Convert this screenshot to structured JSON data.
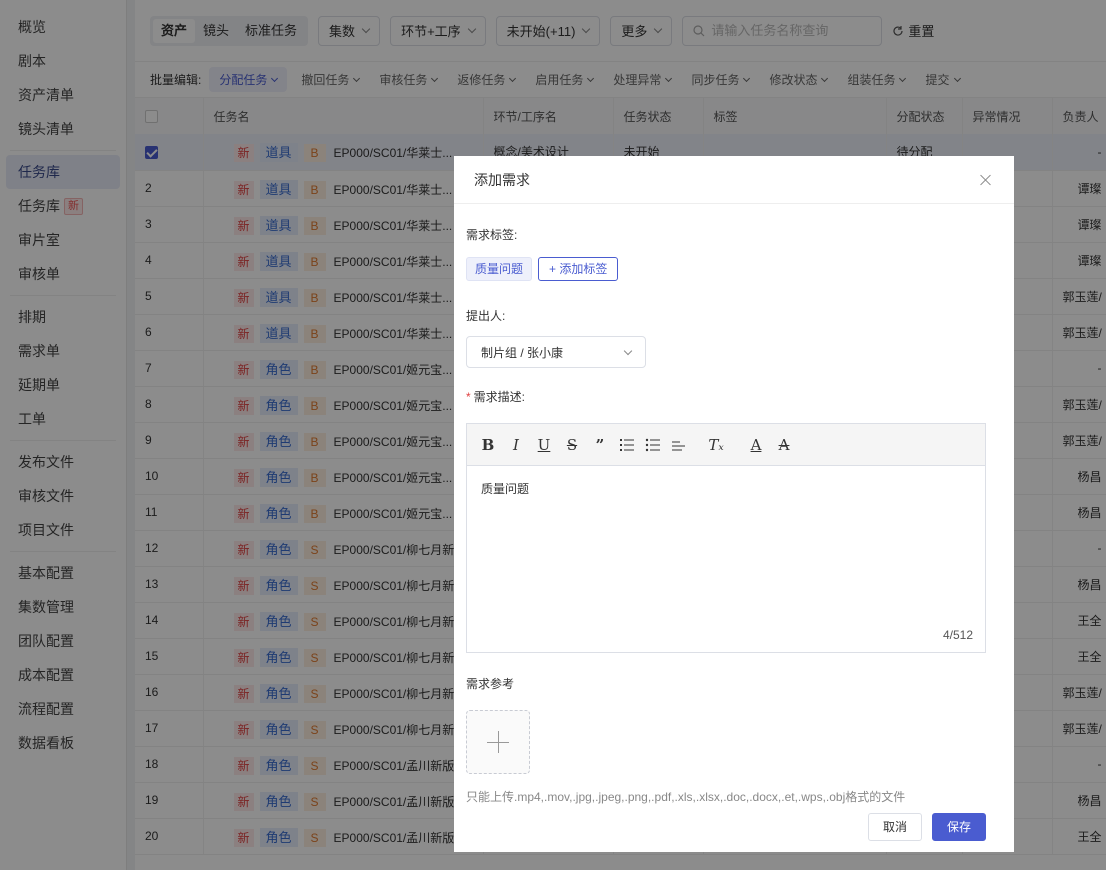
{
  "sidebar": {
    "groups": [
      [
        "概览",
        "剧本",
        "资产清单",
        "镜头清单"
      ],
      [
        "任务库",
        "任务库",
        "审片室",
        "审核单"
      ],
      [
        "排期",
        "需求单",
        "延期单",
        "工单"
      ],
      [
        "发布文件",
        "审核文件",
        "项目文件"
      ],
      [
        "基本配置",
        "集数管理",
        "团队配置",
        "成本配置",
        "流程配置",
        "数据看板"
      ]
    ],
    "new_tag": "新"
  },
  "toolbar": {
    "seg": [
      "资产",
      "镜头",
      "标准任务"
    ],
    "filters": [
      "集数",
      "环节+工序",
      "未开始(+11)",
      "更多"
    ],
    "search_placeholder": "请输入任务名称查询",
    "reset": "重置"
  },
  "batch": {
    "label": "批量编辑:",
    "items": [
      "分配任务",
      "撤回任务",
      "审核任务",
      "返修任务",
      "启用任务",
      "处理异常",
      "同步任务",
      "修改状态",
      "组装任务",
      "提交"
    ]
  },
  "table": {
    "headers": [
      "任务名",
      "环节/工序名",
      "任务状态",
      "标签",
      "分配状态",
      "异常情况",
      "负责人"
    ],
    "rows": [
      {
        "no": "",
        "new": "新",
        "type": "道具",
        "grade": "B",
        "name": "EP000/SC01/华莱士...",
        "step": "概念/美术设计",
        "status": "未开始",
        "assign": "待分配",
        "owner": "-"
      },
      {
        "no": "2",
        "new": "新",
        "type": "道具",
        "grade": "B",
        "name": "EP000/SC01/华莱士...",
        "step": "",
        "status": "",
        "assign": "",
        "owner": "谭璨"
      },
      {
        "no": "3",
        "new": "新",
        "type": "道具",
        "grade": "B",
        "name": "EP000/SC01/华莱士...",
        "step": "",
        "status": "",
        "assign": "",
        "owner": "谭璨"
      },
      {
        "no": "4",
        "new": "新",
        "type": "道具",
        "grade": "B",
        "name": "EP000/SC01/华莱士...",
        "step": "",
        "status": "",
        "assign": "",
        "owner": "谭璨"
      },
      {
        "no": "5",
        "new": "新",
        "type": "道具",
        "grade": "B",
        "name": "EP000/SC01/华莱士...",
        "step": "",
        "status": "",
        "assign": "",
        "owner": "郭玉莲/"
      },
      {
        "no": "6",
        "new": "新",
        "type": "道具",
        "grade": "B",
        "name": "EP000/SC01/华莱士...",
        "step": "",
        "status": "",
        "assign": "",
        "owner": "郭玉莲/"
      },
      {
        "no": "7",
        "new": "新",
        "type": "角色",
        "grade": "B",
        "name": "EP000/SC01/姬元宝...",
        "step": "",
        "status": "",
        "assign": "",
        "owner": "-"
      },
      {
        "no": "8",
        "new": "新",
        "type": "角色",
        "grade": "B",
        "name": "EP000/SC01/姬元宝...",
        "step": "",
        "status": "",
        "assign": "",
        "owner": "郭玉莲/"
      },
      {
        "no": "9",
        "new": "新",
        "type": "角色",
        "grade": "B",
        "name": "EP000/SC01/姬元宝...",
        "step": "",
        "status": "",
        "assign": "",
        "owner": "郭玉莲/"
      },
      {
        "no": "10",
        "new": "新",
        "type": "角色",
        "grade": "B",
        "name": "EP000/SC01/姬元宝...",
        "step": "",
        "status": "",
        "assign": "",
        "owner": "杨昌"
      },
      {
        "no": "11",
        "new": "新",
        "type": "角色",
        "grade": "B",
        "name": "EP000/SC01/姬元宝...",
        "step": "",
        "status": "",
        "assign": "",
        "owner": "杨昌"
      },
      {
        "no": "12",
        "new": "新",
        "type": "角色",
        "grade": "S",
        "name": "EP000/SC01/柳七月新",
        "step": "",
        "status": "",
        "assign": "",
        "owner": "-"
      },
      {
        "no": "13",
        "new": "新",
        "type": "角色",
        "grade": "S",
        "name": "EP000/SC01/柳七月新",
        "step": "",
        "status": "",
        "assign": "",
        "owner": "杨昌"
      },
      {
        "no": "14",
        "new": "新",
        "type": "角色",
        "grade": "S",
        "name": "EP000/SC01/柳七月新",
        "step": "",
        "status": "",
        "assign": "",
        "owner": "王全"
      },
      {
        "no": "15",
        "new": "新",
        "type": "角色",
        "grade": "S",
        "name": "EP000/SC01/柳七月新",
        "step": "",
        "status": "",
        "assign": "",
        "owner": "王全"
      },
      {
        "no": "16",
        "new": "新",
        "type": "角色",
        "grade": "S",
        "name": "EP000/SC01/柳七月新",
        "step": "",
        "status": "",
        "assign": "",
        "owner": "郭玉莲/"
      },
      {
        "no": "17",
        "new": "新",
        "type": "角色",
        "grade": "S",
        "name": "EP000/SC01/柳七月新",
        "step": "",
        "status": "",
        "assign": "",
        "owner": "郭玉莲/"
      },
      {
        "no": "18",
        "new": "新",
        "type": "角色",
        "grade": "S",
        "name": "EP000/SC01/孟川新版",
        "step": "",
        "status": "",
        "assign": "",
        "owner": "-"
      },
      {
        "no": "19",
        "new": "新",
        "type": "角色",
        "grade": "S",
        "name": "EP000/SC01/孟川新版",
        "step": "",
        "status": "",
        "assign": "",
        "owner": "杨昌"
      },
      {
        "no": "20",
        "new": "新",
        "type": "角色",
        "grade": "S",
        "name": "EP000/SC01/孟川新版",
        "step": "",
        "status": "",
        "assign": "",
        "owner": "王全"
      }
    ]
  },
  "dialog": {
    "title": "添加需求",
    "tags_label": "需求标签:",
    "tag": "质量问题",
    "add_tag": "+ 添加标签",
    "proposer_label": "提出人:",
    "proposer_value": "制片组 / 张小康",
    "desc_label": "需求描述:",
    "required_mark": "*",
    "editor_text": "质量问题",
    "counter": "4/512",
    "ref_label": "需求参考",
    "upload_hint": "只能上传.mp4,.mov,.jpg,.jpeg,.png,.pdf,.xls,.xlsx,.doc,.docx,.et,.wps,.obj格式的文件",
    "cancel": "取消",
    "save": "保存"
  }
}
